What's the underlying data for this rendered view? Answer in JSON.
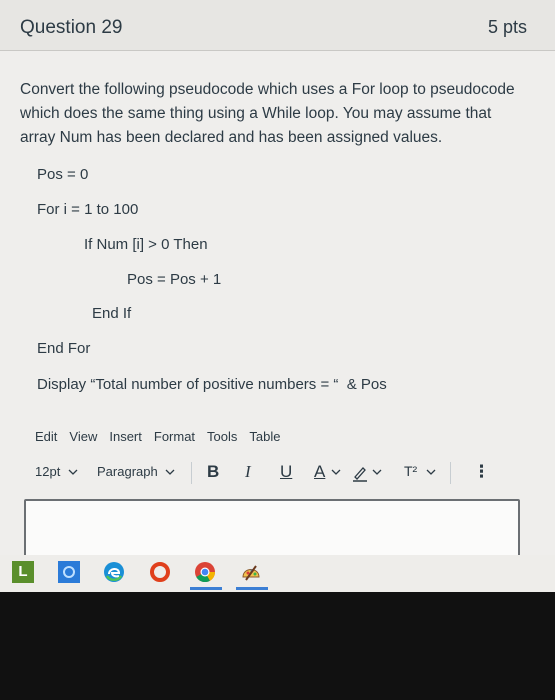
{
  "question": {
    "title": "Question 29",
    "points": "5 pts",
    "prompt": "Convert the following pseudocode which uses a For loop to pseudocode which does the same thing using a While loop. You may assume that array Num has been declared and has been assigned values.",
    "code": [
      "Pos = 0",
      "For i = 1 to 100",
      "If Num [i] > 0 Then",
      "Pos = Pos + 1",
      "End If",
      "End For",
      "Display “Total number of positive numbers = “  & Pos"
    ]
  },
  "editor": {
    "menu": [
      "Edit",
      "View",
      "Insert",
      "Format",
      "Tools",
      "Table"
    ],
    "font_size": "12pt",
    "paragraph": "Paragraph",
    "bold": "B",
    "italic": "I",
    "underline": "U",
    "text_color": "A",
    "superscript": "T²",
    "more": "⋮"
  },
  "taskbar": {
    "icons": [
      "app-l-icon",
      "store-icon",
      "edge-icon",
      "office-icon",
      "chrome-icon",
      "paint-icon"
    ]
  },
  "colors": {
    "text": "#2d3b45",
    "page_bg": "#efeeec",
    "header_bg": "#e7e6e3"
  }
}
